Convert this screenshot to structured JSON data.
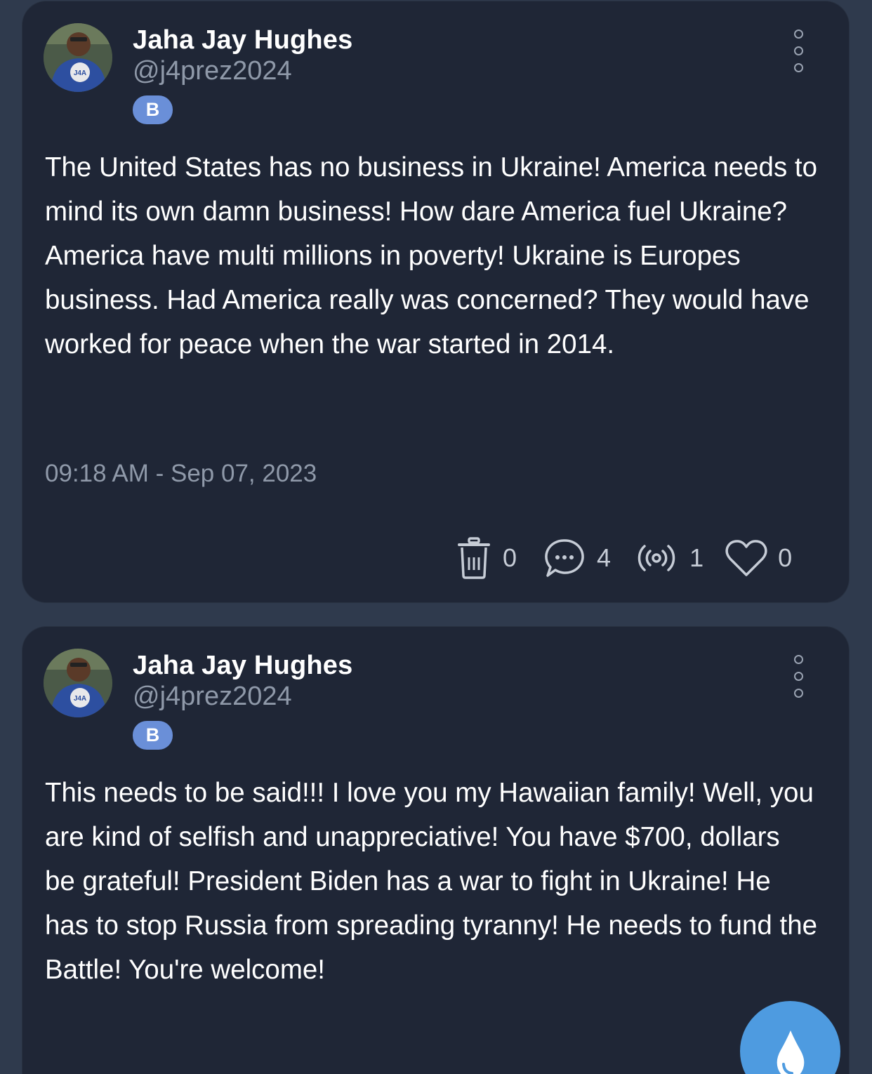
{
  "posts": [
    {
      "author": {
        "name": "Jaha Jay Hughes",
        "handle": "@j4prez2024",
        "avatar_shirt_text": "J4A",
        "badge": "B"
      },
      "text": "The United States has no business in Ukraine! America needs to mind its own damn business! How dare America fuel Ukraine? America have multi millions in poverty! Ukraine is Europes business. Had America really was concerned? They would have worked for peace when the war started in 2014.",
      "timestamp": "09:18 AM - Sep 07, 2023",
      "actions": {
        "delete_count": "0",
        "comment_count": "4",
        "broadcast_count": "1",
        "like_count": "0"
      }
    },
    {
      "author": {
        "name": "Jaha Jay Hughes",
        "handle": "@j4prez2024",
        "avatar_shirt_text": "J4A",
        "badge": "B"
      },
      "text": "This needs to be said!!! I love you my Hawaiian family! Well, you are kind of selfish and unappreciative! You have $700, dollars be grateful! President Biden has a war to fight in Ukraine! He has to stop Russia from spreading tyranny! He needs to fund the Battle! You're welcome!"
    }
  ],
  "icons": {
    "menu": "more-vertical-icon",
    "delete": "trash-icon",
    "comment": "comment-bubble-icon",
    "broadcast": "broadcast-icon",
    "like": "heart-icon",
    "fab": "water-drop-icon"
  },
  "colors": {
    "background": "#2f3a4d",
    "card": "#1f2636",
    "badge": "#6a8fd8",
    "fab": "#4e9be0",
    "muted_text": "#8f99a9"
  }
}
